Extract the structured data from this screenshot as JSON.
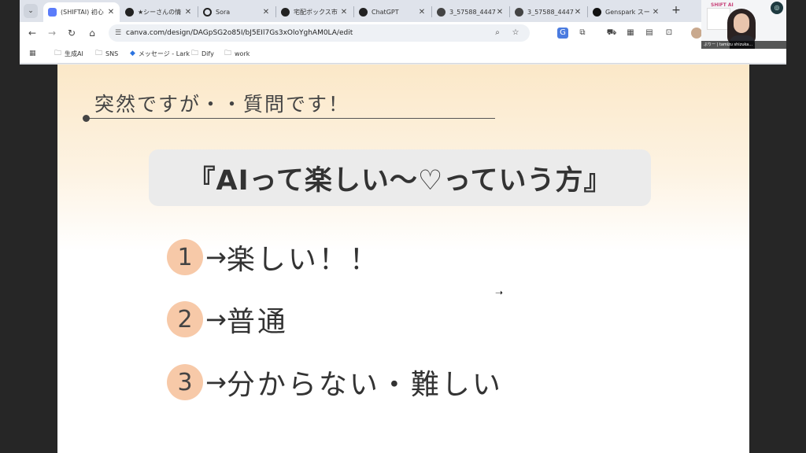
{
  "browser": {
    "tabs": [
      {
        "label": "(SHIFTAI) 初心",
        "icon": "shiftai-favicon-icon",
        "active": true
      },
      {
        "label": "★シーさんの情",
        "icon": "openai-favicon-icon"
      },
      {
        "label": "Sora",
        "icon": "sora-favicon-icon"
      },
      {
        "label": "宅配ボックス市",
        "icon": "openai-favicon-icon"
      },
      {
        "label": "ChatGPT",
        "icon": "openai-favicon-icon"
      },
      {
        "label": "3_57588_4447",
        "icon": "globe-icon"
      },
      {
        "label": "3_57588_4447",
        "icon": "globe-icon"
      },
      {
        "label": "Genspark スー",
        "icon": "genspark-favicon-icon"
      }
    ],
    "tab_close_glyph": "✕",
    "new_tab_glyph": "+",
    "url": "canva.com/design/DAGpSG2o85I/bJ5EIl7Gs3xOloYghAM0LA/edit",
    "bookmarks": [
      {
        "label": "生成AI",
        "icon": "folder-icon"
      },
      {
        "label": "SNS",
        "icon": "folder-icon"
      },
      {
        "label": "メッセージ - Lark",
        "icon": "lark-icon"
      },
      {
        "label": "Dify",
        "icon": "folder-icon"
      },
      {
        "label": "work",
        "icon": "folder-icon"
      }
    ],
    "colors": {
      "tabbar": "#dfe3eb",
      "active_tab": "#ffffff",
      "omnibox": "#eef1f5"
    }
  },
  "webcam": {
    "brand": "SHIFT AI",
    "caption": "ぷりー | tamizu shizuka..."
  },
  "slide": {
    "question": "突然ですが・・質問です！",
    "headline": "『AIって楽しい〜♡っていう方』",
    "items": [
      {
        "number": "1",
        "text": "楽しい！！"
      },
      {
        "number": "2",
        "text": "普通"
      },
      {
        "number": "3",
        "text": "分からない・難しい"
      }
    ],
    "arrow": "→",
    "colors": {
      "number_circle": "#f7c9a8",
      "headline_pill": "#ebebeb",
      "gradient_top": "#fbe8c8"
    }
  }
}
